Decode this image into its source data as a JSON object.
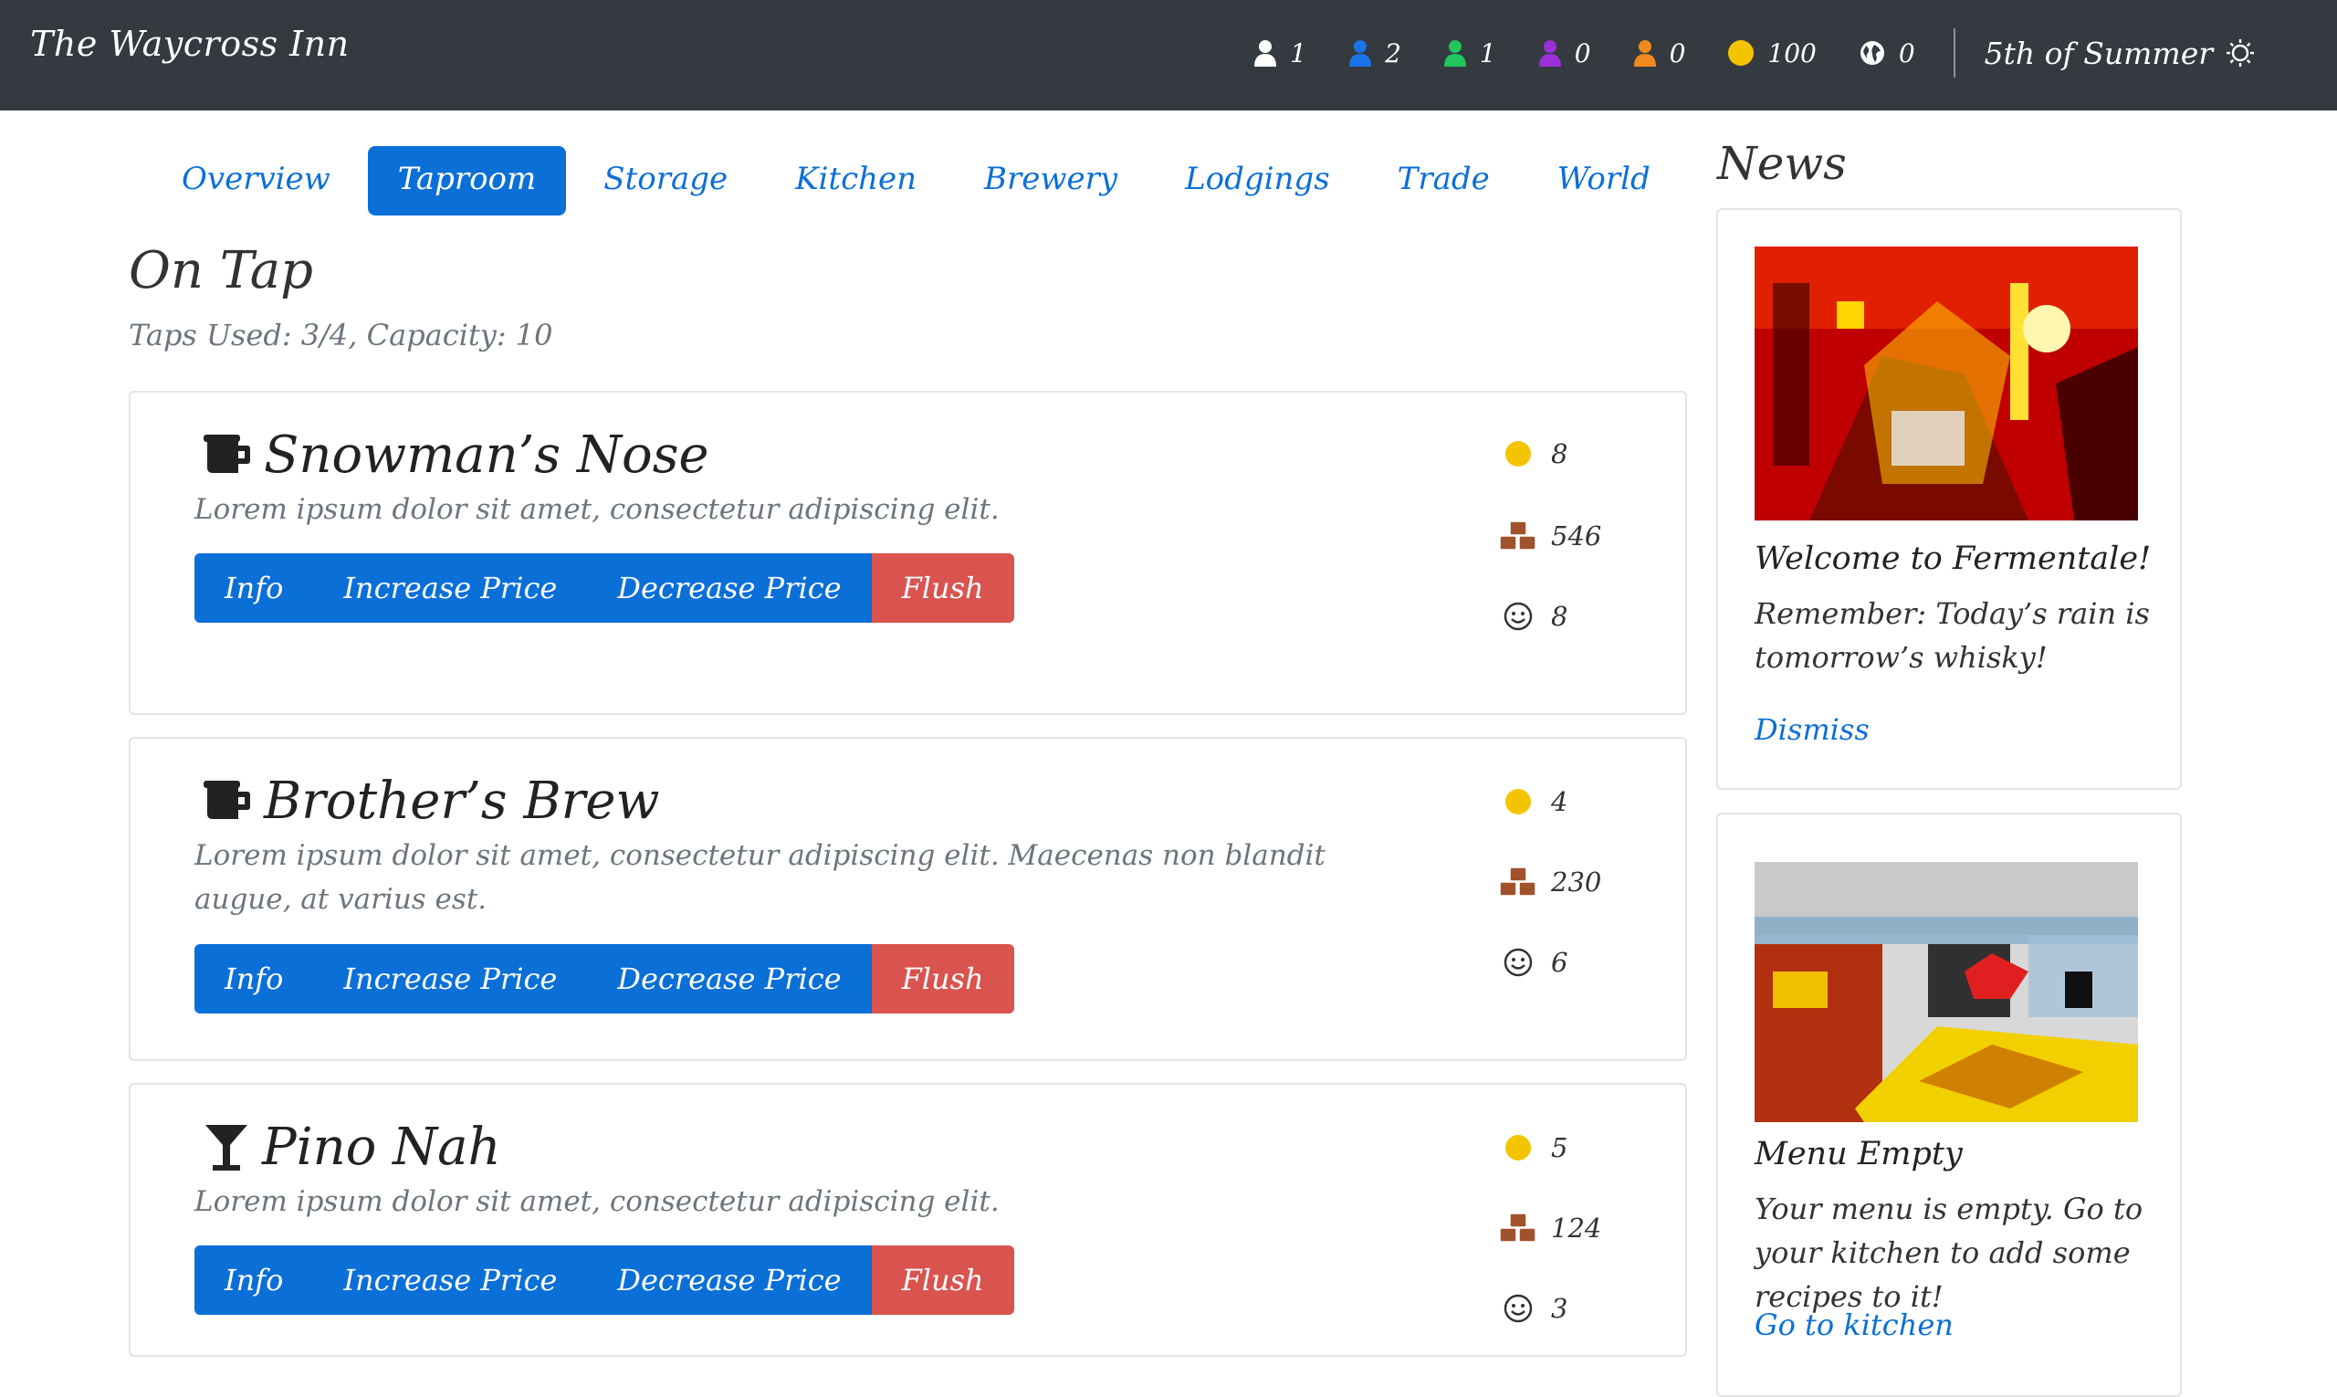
{
  "navbar": {
    "brand": "The Waycross Inn",
    "stats": [
      {
        "icon": "person-white-icon",
        "color": "#ffffff",
        "value": "1"
      },
      {
        "icon": "person-blue-icon",
        "color": "#1a73e8",
        "value": "2"
      },
      {
        "icon": "person-green-icon",
        "color": "#22c55e",
        "value": "1"
      },
      {
        "icon": "person-purple-icon",
        "color": "#9b30d9",
        "value": "0"
      },
      {
        "icon": "person-orange-icon",
        "color": "#f08a1c",
        "value": "0"
      },
      {
        "icon": "gold-coin-icon",
        "color": "#f5c400",
        "value": "100"
      },
      {
        "icon": "globe-icon",
        "color": "#ffffff",
        "value": "0"
      }
    ],
    "date": "5th of Summer"
  },
  "tabs": [
    {
      "label": "Overview",
      "active": false
    },
    {
      "label": "Taproom",
      "active": true
    },
    {
      "label": "Storage",
      "active": false
    },
    {
      "label": "Kitchen",
      "active": false
    },
    {
      "label": "Brewery",
      "active": false
    },
    {
      "label": "Lodgings",
      "active": false
    },
    {
      "label": "Trade",
      "active": false
    },
    {
      "label": "World",
      "active": false
    }
  ],
  "section": {
    "title": "On Tap",
    "subtitle": "Taps Used: 3/4, Capacity: 10"
  },
  "buttons": {
    "info": "Info",
    "increase": "Increase Price",
    "decrease": "Decrease Price",
    "flush": "Flush"
  },
  "drinks": [
    {
      "name": "Snowman’s Nose",
      "icon": "beer-mug-icon",
      "description": "Lorem ipsum dolor sit amet, consectetur adipiscing elit.",
      "price": "8",
      "stock": "546",
      "happiness": "8"
    },
    {
      "name": "Brother’s Brew",
      "icon": "beer-mug-icon",
      "description": "Lorem ipsum dolor sit amet, consectetur adipiscing elit. Maecenas non blandit augue, at varius est.",
      "price": "4",
      "stock": "230",
      "happiness": "6"
    },
    {
      "name": "Pino Nah",
      "icon": "cocktail-glass-icon",
      "description": "Lorem ipsum dolor sit amet, consectetur adipiscing elit.",
      "price": "5",
      "stock": "124",
      "happiness": "3"
    }
  ],
  "news": {
    "title": "News",
    "items": [
      {
        "headline": "Welcome to Fermentale!",
        "body": "Remember: Today’s rain is tomorrow’s whisky!",
        "action": "Dismiss"
      },
      {
        "headline": "Menu Empty",
        "body": "Your menu is empty. Go to your kitchen to add some recipes to it!",
        "action": "Go to kitchen"
      }
    ]
  },
  "colors": {
    "primary": "#0b6fd8",
    "danger": "#d9534f",
    "navbar": "#343a40",
    "coin": "#f5c400",
    "crates": "#a0522d"
  }
}
